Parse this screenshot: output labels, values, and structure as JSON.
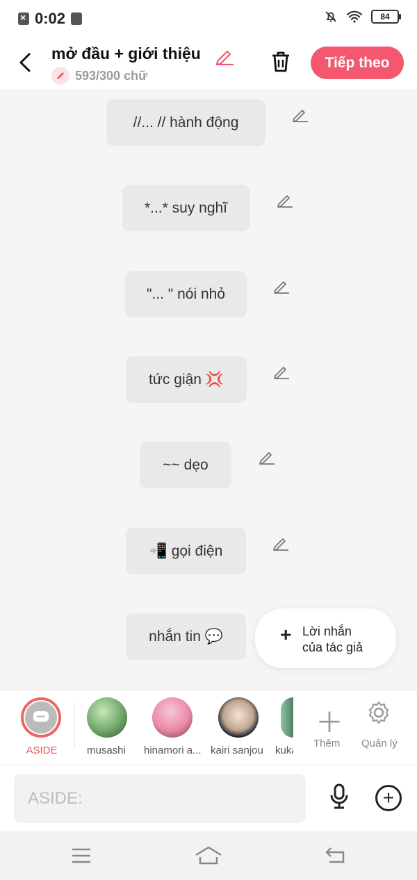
{
  "status": {
    "time": "0:02",
    "battery": "84"
  },
  "header": {
    "title": "mở đầu + giới thiệu",
    "count": "593/300 chữ",
    "next": "Tiếp theo"
  },
  "bubbles": [
    "//... // hành động",
    "*...* suy nghĩ",
    "\"... \" nói nhỏ",
    "tức giận 💢",
    "~~ dẹo",
    "📲 gọi điện",
    "nhắn tin 💬"
  ],
  "author_note": {
    "line1": "Lời nhắn",
    "line2": "của tác giả"
  },
  "characters": [
    {
      "name": "ASIDE",
      "active": true
    },
    {
      "name": "musashi"
    },
    {
      "name": "hinamori a..."
    },
    {
      "name": "kairi sanjou"
    },
    {
      "name": "kuka"
    }
  ],
  "actions": {
    "add": "Thêm",
    "manage": "Quản lý"
  },
  "input": {
    "placeholder": "ASIDE:"
  },
  "colors": {
    "accent": "#f4586e"
  }
}
